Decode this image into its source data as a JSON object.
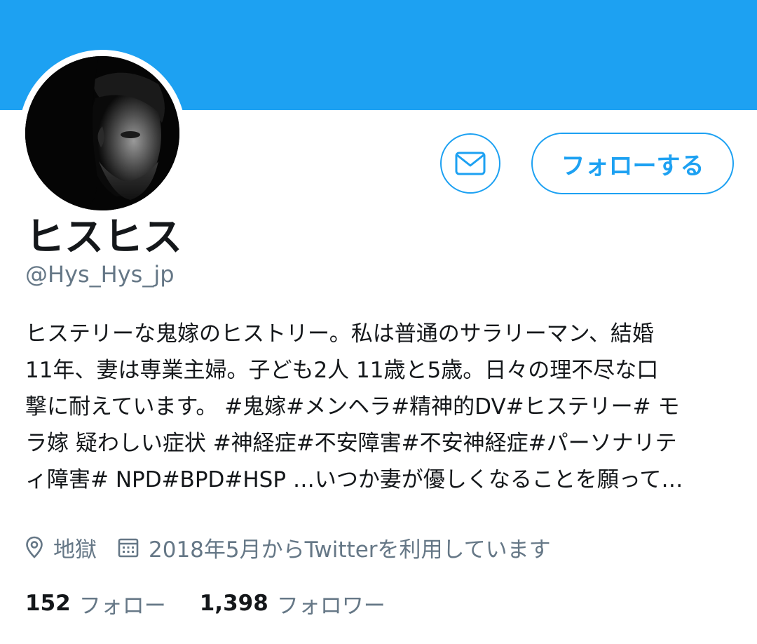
{
  "profile": {
    "display_name": "ヒスヒス",
    "handle": "@Hys_Hys_jp",
    "bio_lines": [
      "ヒステリーな鬼嫁のヒストリー。私は普通のサラリーマン、結婚",
      "11年、妻は専業主婦。子ども2人 11歳と5歳。日々の理不尽な口",
      "撃に耐えています。 #鬼嫁#メンヘラ#精神的DV#ヒステリー# モ",
      "ラ嫁 疑わしい症状 #神経症#不安障害#不安神経症#パーソナリテ",
      "ィ障害# NPD#BPD#HSP …いつか妻が優しくなることを願って…"
    ],
    "location": "地獄",
    "joined": "2018年5月からTwitterを利用しています",
    "location_icon": "location-pin-icon",
    "calendar_icon": "calendar-icon"
  },
  "actions": {
    "message_icon": "envelope-icon",
    "follow_label": "フォローする"
  },
  "stats": {
    "following_count": "152",
    "following_label": "フォロー",
    "followers_count": "1,398",
    "followers_label": "フォロワー"
  },
  "colors": {
    "accent": "#1da1f2",
    "text_primary": "#14171a",
    "text_secondary": "#657786"
  }
}
